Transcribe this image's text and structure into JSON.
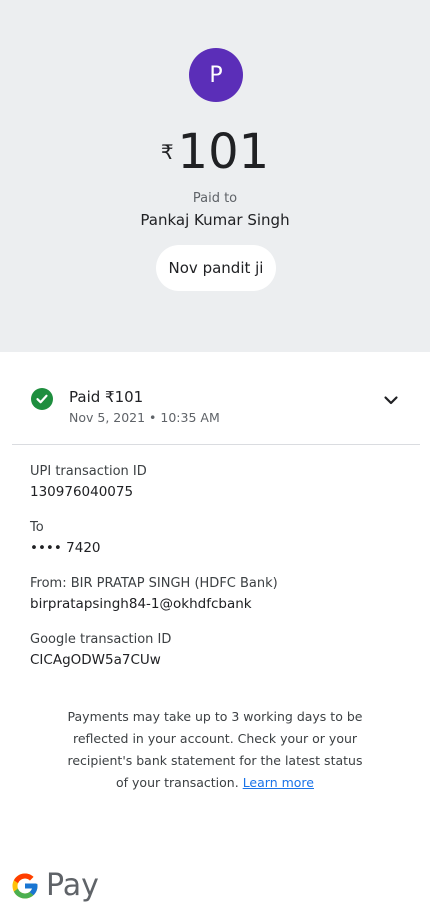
{
  "header": {
    "avatar_letter": "P",
    "currency_symbol": "₹",
    "amount": "101",
    "paid_to_label": "Paid to",
    "payee_name": "Pankaj Kumar Singh",
    "note": "Nov pandit ji"
  },
  "status": {
    "title": "Paid ₹101",
    "datetime": "Nov 5, 2021 • 10:35 AM"
  },
  "details": {
    "upi_label": "UPI transaction ID",
    "upi_value": "130976040075",
    "to_label": "To",
    "to_value": "•••• 7420",
    "from_label": "From: BIR PRATAP SINGH (HDFC Bank)",
    "from_value": "birpratapsingh84-1@okhdfcbank",
    "google_label": "Google transaction ID",
    "google_value": "CICAgODW5a7CUw"
  },
  "disclaimer": {
    "text": "Payments may take up to 3 working days to be reflected in your account. Check your or your recipient's bank statement for the latest status of your transaction.",
    "link_text": "Learn more"
  },
  "brand": {
    "pay_text": "Pay"
  },
  "colors": {
    "avatar": "#5b2eb8",
    "success": "#1e8e3e",
    "link": "#1a73e8",
    "header_bg": "#eceef0"
  }
}
